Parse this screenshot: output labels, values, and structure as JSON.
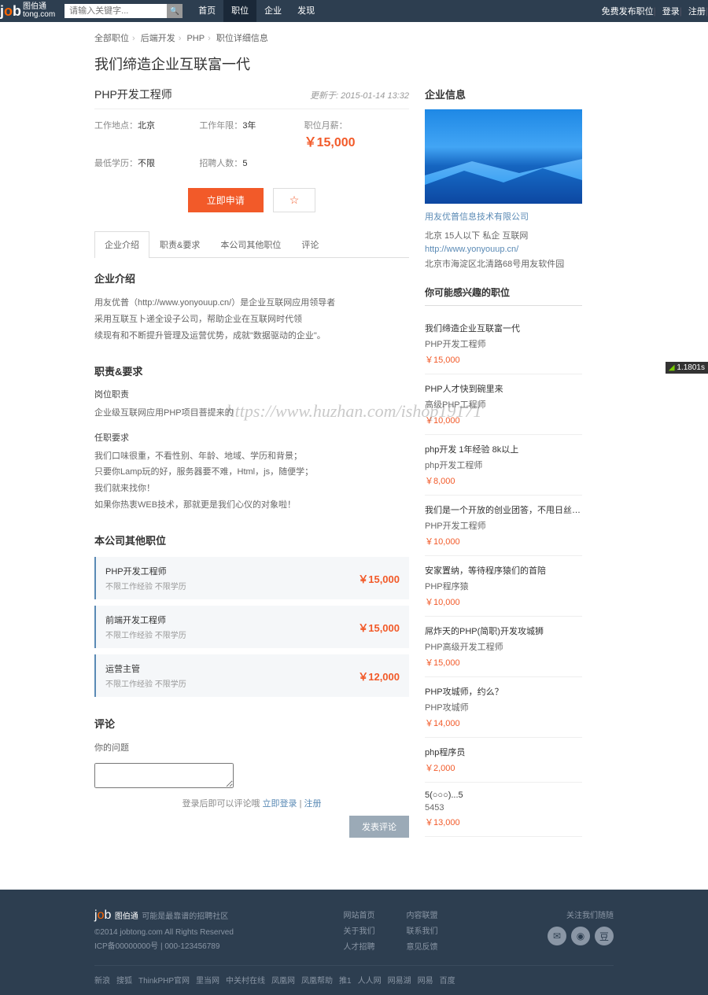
{
  "header": {
    "logo_main": "job",
    "logo_cn": "图伯通",
    "logo_sub": "tong.com",
    "search_placeholder": "请输入关键字...",
    "nav": [
      "首页",
      "职位",
      "企业",
      "发现"
    ],
    "right": [
      "免费发布职位",
      "登录",
      "注册"
    ]
  },
  "breadcrumb": {
    "items": [
      "全部职位",
      "后端开发",
      "PHP",
      "职位详细信息"
    ]
  },
  "page_title": "我们缔造企业互联富一代",
  "job": {
    "title": "PHP开发工程师",
    "time": "更新于: 2015-01-14 13:32",
    "meta": {
      "loc_label": "工作地点：",
      "loc": "北京",
      "exp_label": "工作年限：",
      "exp": "3年",
      "salary_label": "职位月薪：",
      "salary": "￥15,000",
      "edu_label": "最低学历：",
      "edu": "不限",
      "num_label": "招聘人数：",
      "num": "5"
    },
    "apply": "立即申请",
    "fav": "☆"
  },
  "tabs": [
    "企业介绍",
    "职责&要求",
    "本公司其他职位",
    "评论"
  ],
  "intro": {
    "title": "企业介绍",
    "lines": [
      "用友优普（http://www.yonyouup.cn/）是企业互联网应用领导者",
      "采用互联互卜递全设子公司，帮助企业在互联网时代领",
      "续现有和不断提升管理及运营优势，成就\"数据驱动的企业\"。"
    ]
  },
  "duty": {
    "title": "职责&要求",
    "sub1": "岗位职责",
    "l1": "企业级互联网应用PHP项目菩提来的",
    "sub2": "任职要求",
    "lines": [
      "我们口味很重，不看性别、年龄、地域、学历和背景；",
      "只要你Lamp玩的好，服务器要不难，Html，js，随便学；",
      "我们就来找你！",
      "如果你热衷WEB技术，那就更是我们心仪的对象啦！"
    ]
  },
  "others": {
    "title": "本公司其他职位",
    "jobs": [
      {
        "title": "PHP开发工程师",
        "meta": "不限工作经验 不限学历",
        "salary": "￥15,000"
      },
      {
        "title": "前端开发工程师",
        "meta": "不限工作经验 不限学历",
        "salary": "￥15,000"
      },
      {
        "title": "运营主管",
        "meta": "不限工作经验 不限学历",
        "salary": "￥12,000"
      }
    ]
  },
  "comment": {
    "title": "评论",
    "q": "你的问题",
    "tip1": "登录后即可以评论哦 ",
    "login": "立即登录",
    "sep": " | ",
    "reg": "注册",
    "btn": "发表评论"
  },
  "company": {
    "title": "企业信息",
    "name": "用友优普信息技术有限公司",
    "info": "北京   15人以下   私企   互联网",
    "url": "http://www.yonyouup.cn/",
    "addr": "北京市海淀区北清路68号用友软件园"
  },
  "rec": {
    "title": "你可能感兴趣的职位",
    "items": [
      {
        "t1": "我们缔造企业互联富一代",
        "t2": "PHP开发工程师",
        "s": "￥15,000"
      },
      {
        "t1": "PHP人才快到碗里来",
        "t2": "高级PHP工程师",
        "s": "￥10,000"
      },
      {
        "t1": "php开发 1年经验 8k以上",
        "t2": "php开发工程师",
        "s": "￥8,000"
      },
      {
        "t1": "我们是一个开放的创业团答，不甩日丝、都收住，...",
        "t2": "PHP开发工程师",
        "s": "￥10,000"
      },
      {
        "t1": "安家置纳，等待程序猿们的首陪",
        "t2": "PHP程序猿",
        "s": "￥10,000"
      },
      {
        "t1": "屌炸天的PHP(简职)开发攻城狮",
        "t2": "PHP高级开发工程师",
        "s": "￥15,000"
      },
      {
        "t1": "PHP攻城师，约么？",
        "t2": "PHP攻城师",
        "s": "￥14,000"
      },
      {
        "t1": "php程序员",
        "t2": "",
        "s": "￥2,000"
      },
      {
        "t1": "5(○○○)...5",
        "t2": "5453",
        "s": "￥13,000"
      }
    ]
  },
  "footer": {
    "slogan": "可能是最靠谱的招聘社区",
    "copy": "©2014 jobtong.com All Rights Reserved",
    "icp": "ICP备00000000号 | 000-123456789",
    "col1": [
      "网站首页",
      "关于我们",
      "人才招聘"
    ],
    "col2": [
      "内容联盟",
      "联系我们",
      "意见反馈"
    ],
    "social": "关注我们随随",
    "bottom": [
      "新浪",
      "搜狐",
      "ThinkPHP官网",
      "里当网",
      "中关村在线",
      "凤凰网",
      "凤凰帮助",
      "推1",
      "人人网",
      "网易湖",
      "网易",
      "百度"
    ]
  },
  "badge": "1.1801s",
  "watermark": "https://www.huzhan.com/ishop19171"
}
